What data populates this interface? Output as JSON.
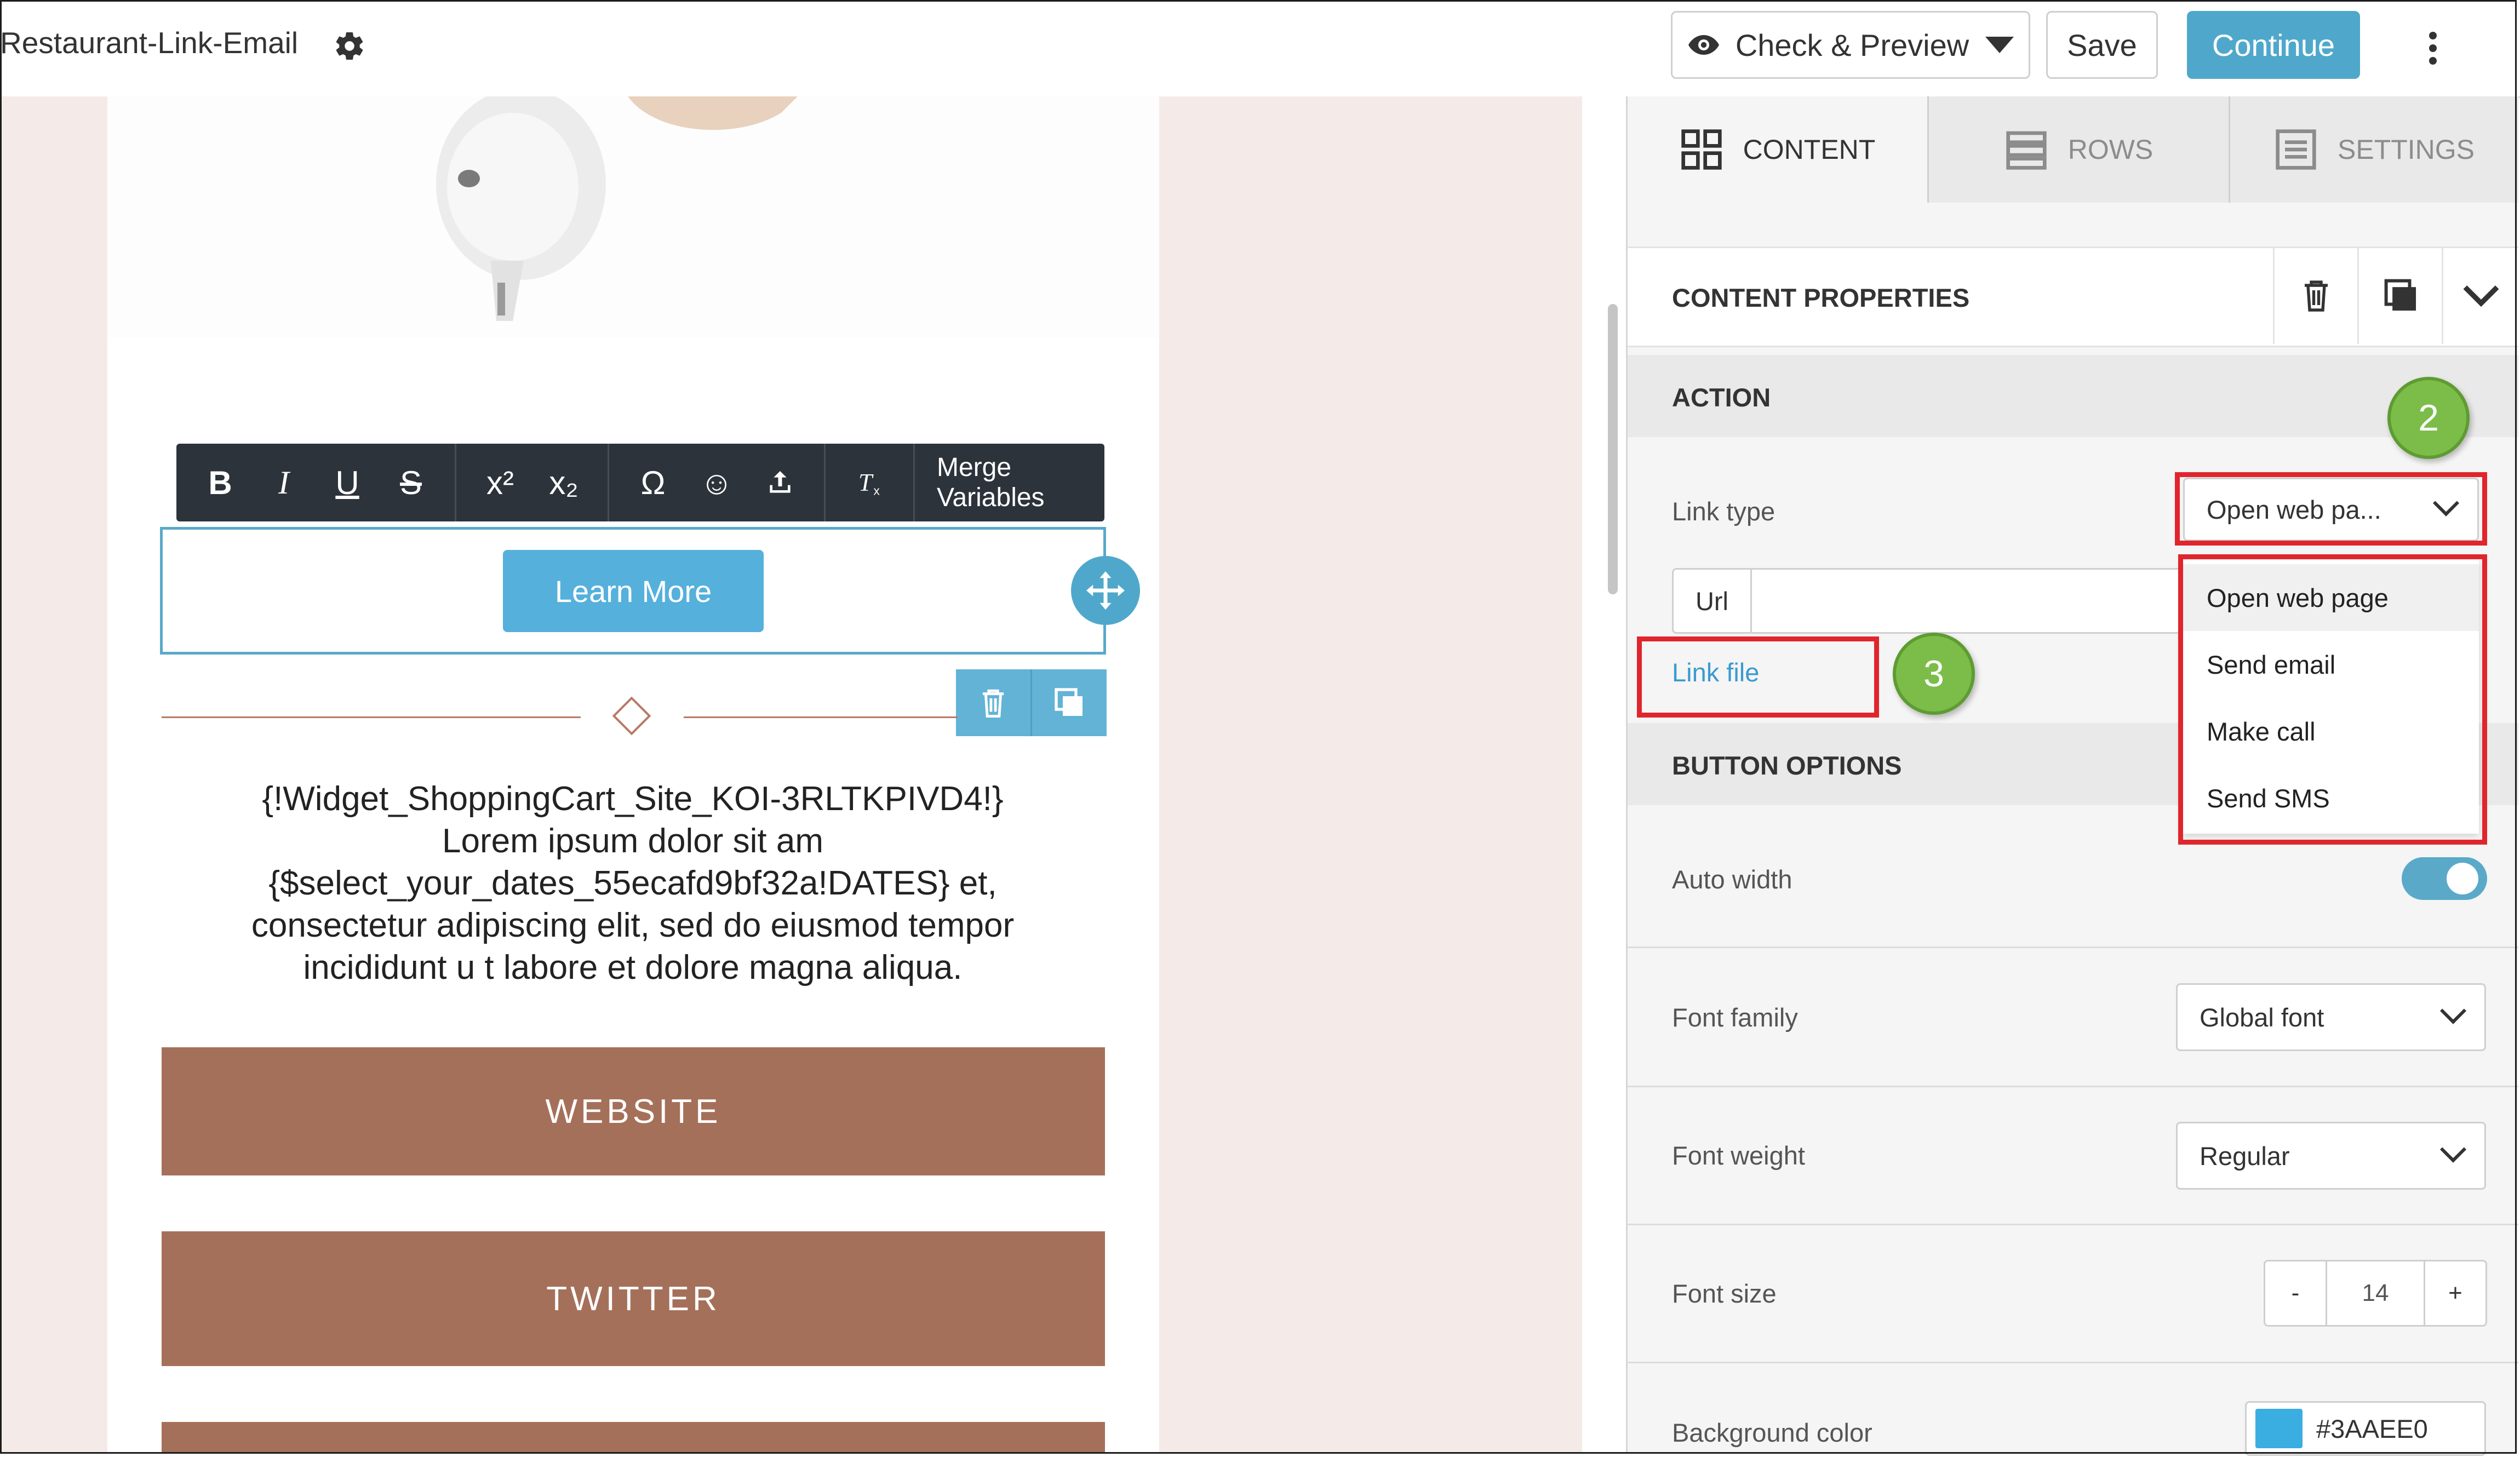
{
  "header": {
    "title": "Restaurant-Link-Email",
    "check_preview_label": "Check & Preview",
    "save_label": "Save",
    "continue_label": "Continue"
  },
  "toolbar": {
    "bold": "B",
    "italic": "I",
    "underline": "U",
    "strike": "S",
    "superscript": "x²",
    "subscript": "x₂",
    "special_char": "Ω",
    "emoji": "☺",
    "merge_label": "Merge Variables"
  },
  "email": {
    "learn_more_label": "Learn More",
    "body_lines": [
      "{!Widget_ShoppingCart_Site_KOI-3RLTKPIVD4!}",
      "Lorem ipsum dolor sit am",
      "{$select_your_dates_55ecafd9bf32a!DATES} et,",
      "consectetur adipiscing elit, sed do eiusmod tempor",
      "incididunt u t labore et dolore magna aliqua."
    ],
    "website_label": "WEBSITE",
    "twitter_label": "TWITTER"
  },
  "panel": {
    "tabs": [
      {
        "label": "CONTENT",
        "icon": "grid-icon",
        "active": true
      },
      {
        "label": "ROWS",
        "icon": "rows-icon",
        "active": false
      },
      {
        "label": "SETTINGS",
        "icon": "settings-list-icon",
        "active": false
      }
    ],
    "content_properties_title": "CONTENT PROPERTIES",
    "action_section": "ACTION",
    "link_type_label": "Link type",
    "link_type_value": "Open web pa...",
    "url_label": "Url",
    "link_file_label": "Link file",
    "link_type_options": [
      "Open web page",
      "Send email",
      "Make call",
      "Send SMS"
    ],
    "button_options_section": "BUTTON OPTIONS",
    "auto_width_label": "Auto width",
    "auto_width_on": true,
    "font_family_label": "Font family",
    "font_family_value": "Global font",
    "font_weight_label": "Font weight",
    "font_weight_value": "Regular",
    "font_size_label": "Font size",
    "font_size_value": "14",
    "font_size_minus": "-",
    "font_size_plus": "+",
    "background_color_label": "Background color",
    "background_color_value": "#3AAEE0"
  },
  "annotations": {
    "step_2": "2",
    "step_3": "3"
  },
  "colors": {
    "accent": "#4fa8cb",
    "button_brown": "#a5705a",
    "annotation_red": "#e0252c",
    "annotation_green": "#7cbd4a"
  }
}
